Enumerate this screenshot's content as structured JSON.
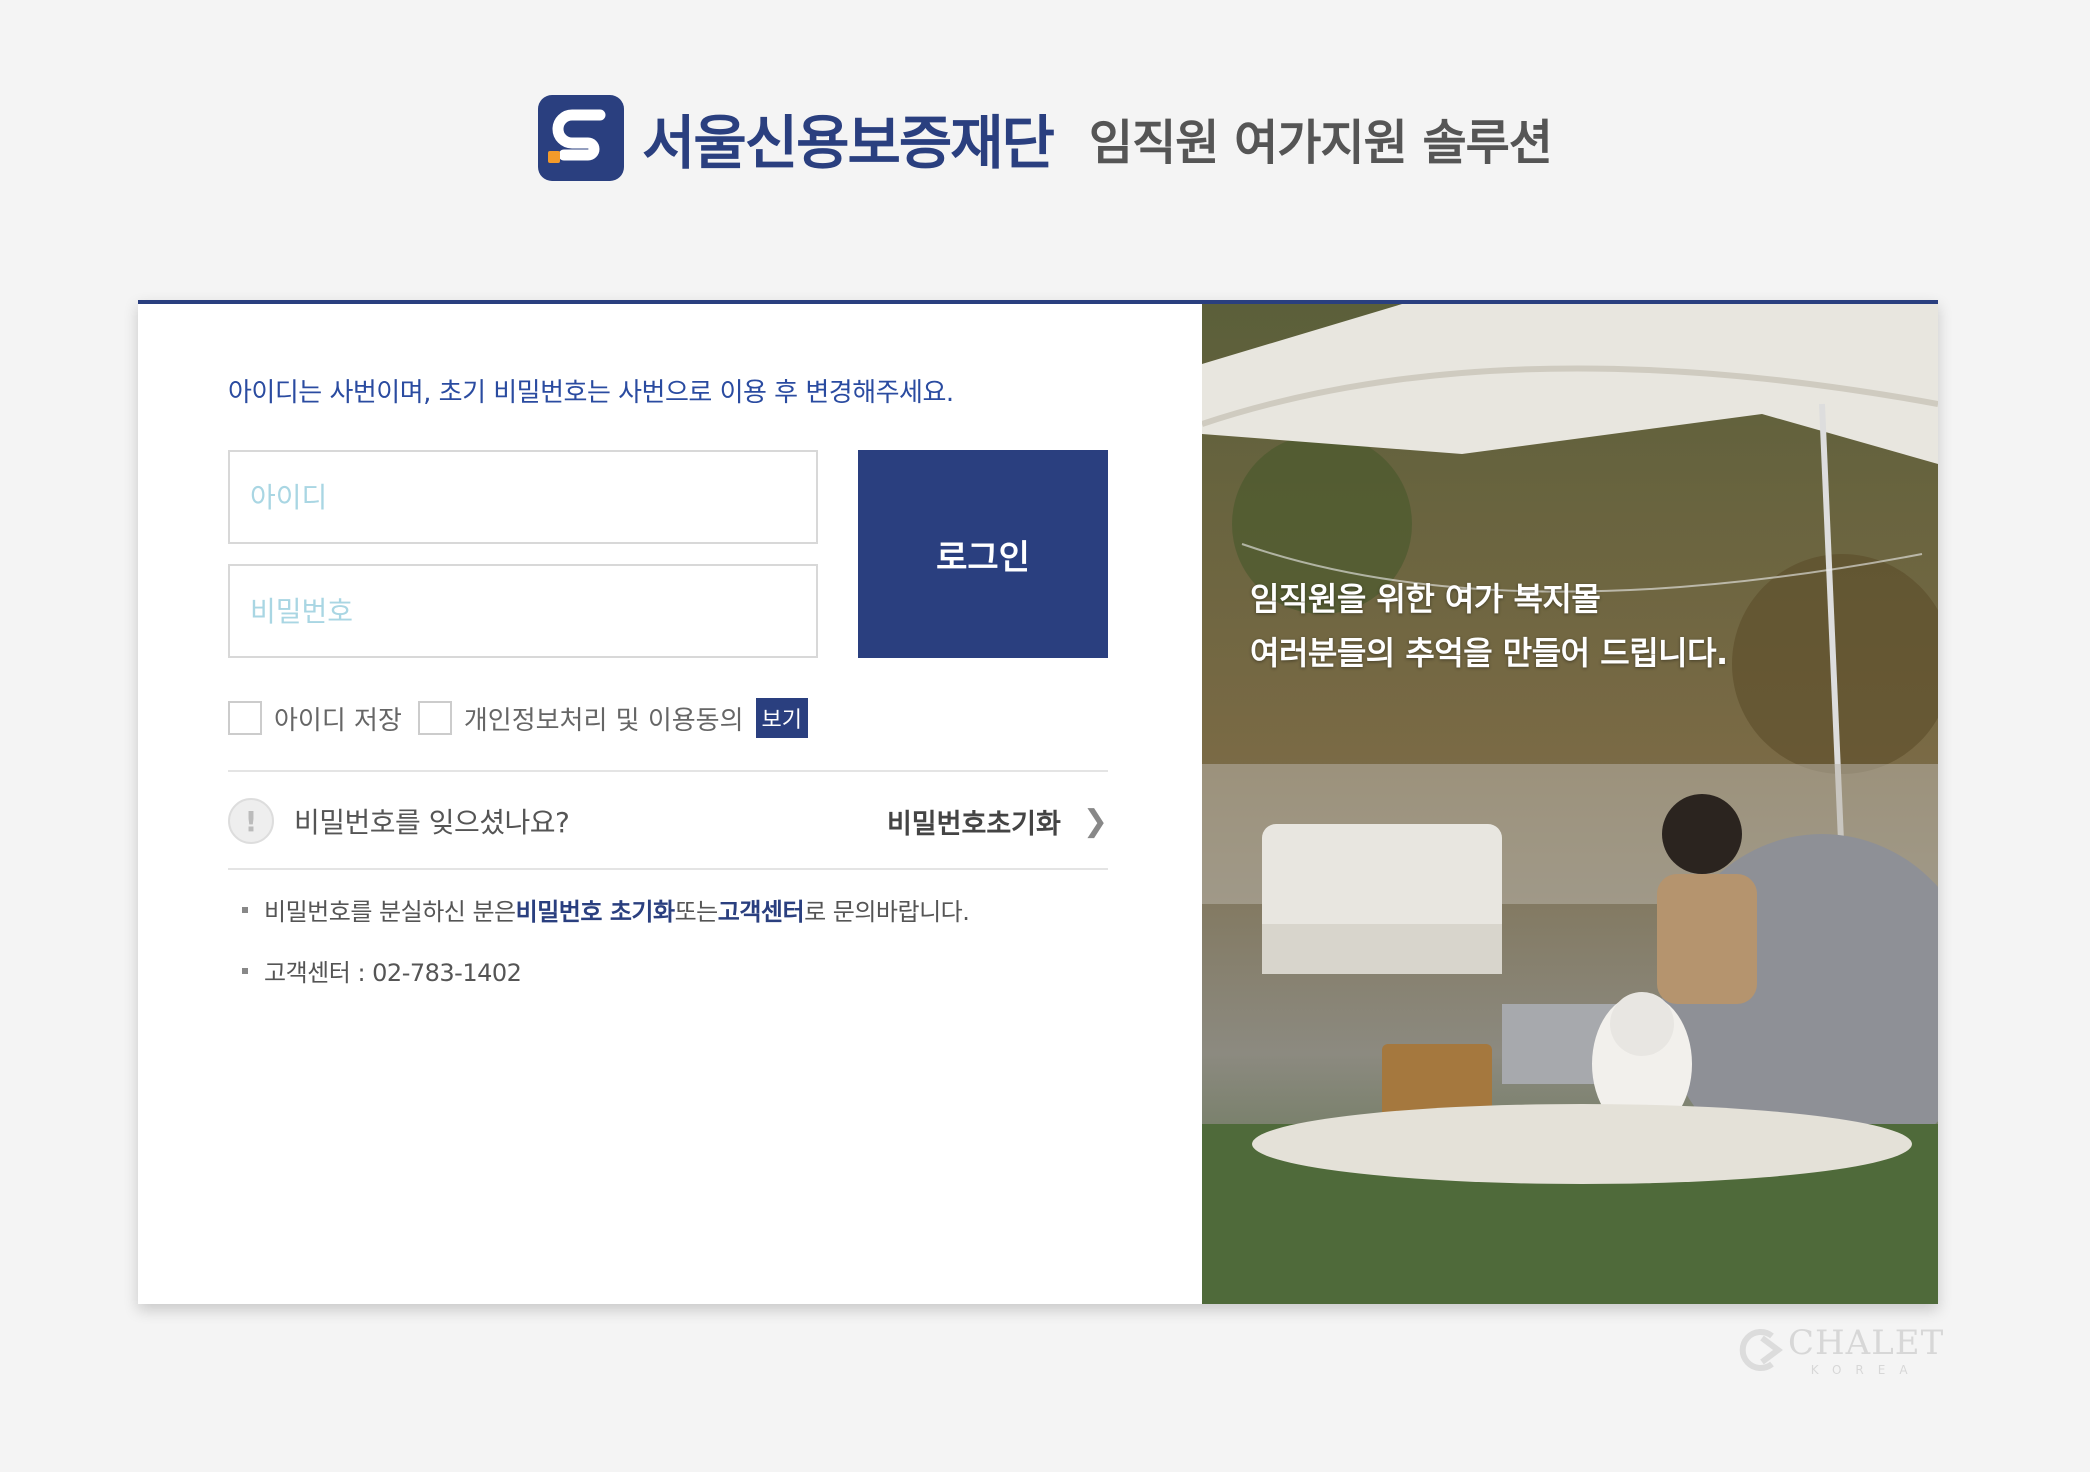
{
  "header": {
    "brand_name": "서울신용보증재단",
    "service_name": "임직원 여가지원 솔루션",
    "logo_icon": "seoul-credit-logo-icon"
  },
  "login": {
    "notice": "아이디는 사번이며, 초기 비밀번호는 사번으로 이용 후 변경해주세요.",
    "id_placeholder": "아이디",
    "pw_placeholder": "비밀번호",
    "login_label": "로그인",
    "save_id_label": "아이디 저장",
    "privacy_label": "개인정보처리 및 이용동의",
    "view_label": "보기",
    "forgot_question": "비밀번호를 잊으셨나요?",
    "reset_label": "비밀번호초기화",
    "info": {
      "line1_pre": "비밀번호를 분실하신 분은 ",
      "line1_em1": "비밀번호 초기화",
      "line1_mid": " 또는 ",
      "line1_em2": "고객센터",
      "line1_post": "로 문의바랍니다.",
      "line2": "고객센터 : 02-783-1402"
    }
  },
  "promo": {
    "line1": "임직원을 위한 여가 복지몰",
    "line2": "여러분들의 추억을 만들어 드립니다."
  },
  "watermark": {
    "text": "CHALET",
    "sub": "KOREA"
  },
  "colors": {
    "brand": "#2a3f7f",
    "notice": "#2a4ba0",
    "placeholder": "#a9d6e3"
  }
}
